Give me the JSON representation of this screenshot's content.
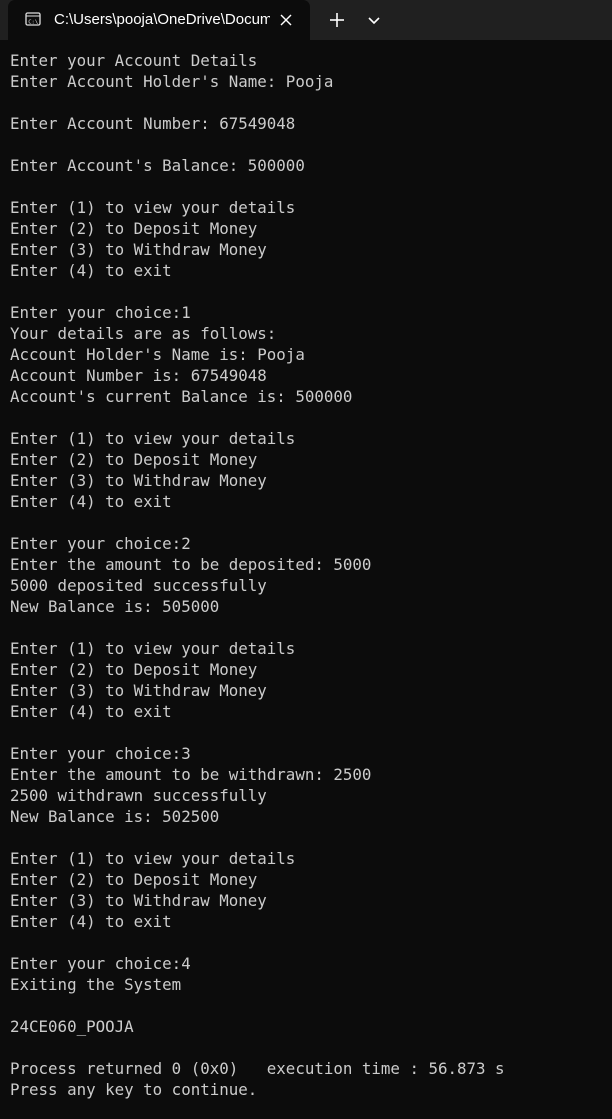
{
  "window": {
    "tab_title": "C:\\Users\\pooja\\OneDrive\\Documents",
    "tab_icon": "terminal-icon",
    "close_icon": "close-icon",
    "new_tab_icon": "plus-icon",
    "dropdown_icon": "chevron-down-icon"
  },
  "console": {
    "lines": [
      "Enter your Account Details",
      "Enter Account Holder's Name: Pooja",
      "",
      "Enter Account Number: 67549048",
      "",
      "Enter Account's Balance: 500000",
      "",
      "Enter (1) to view your details",
      "Enter (2) to Deposit Money",
      "Enter (3) to Withdraw Money",
      "Enter (4) to exit",
      "",
      "Enter your choice:1",
      "Your details are as follows:",
      "Account Holder's Name is: Pooja",
      "Account Number is: 67549048",
      "Account's current Balance is: 500000",
      "",
      "Enter (1) to view your details",
      "Enter (2) to Deposit Money",
      "Enter (3) to Withdraw Money",
      "Enter (4) to exit",
      "",
      "Enter your choice:2",
      "Enter the amount to be deposited: 5000",
      "5000 deposited successfully",
      "New Balance is: 505000",
      "",
      "Enter (1) to view your details",
      "Enter (2) to Deposit Money",
      "Enter (3) to Withdraw Money",
      "Enter (4) to exit",
      "",
      "Enter your choice:3",
      "Enter the amount to be withdrawn: 2500",
      "2500 withdrawn successfully",
      "New Balance is: 502500",
      "",
      "Enter (1) to view your details",
      "Enter (2) to Deposit Money",
      "Enter (3) to Withdraw Money",
      "Enter (4) to exit",
      "",
      "Enter your choice:4",
      "Exiting the System",
      "",
      "24CE060_POOJA",
      "",
      "Process returned 0 (0x0)   execution time : 56.873 s",
      "Press any key to continue."
    ]
  }
}
